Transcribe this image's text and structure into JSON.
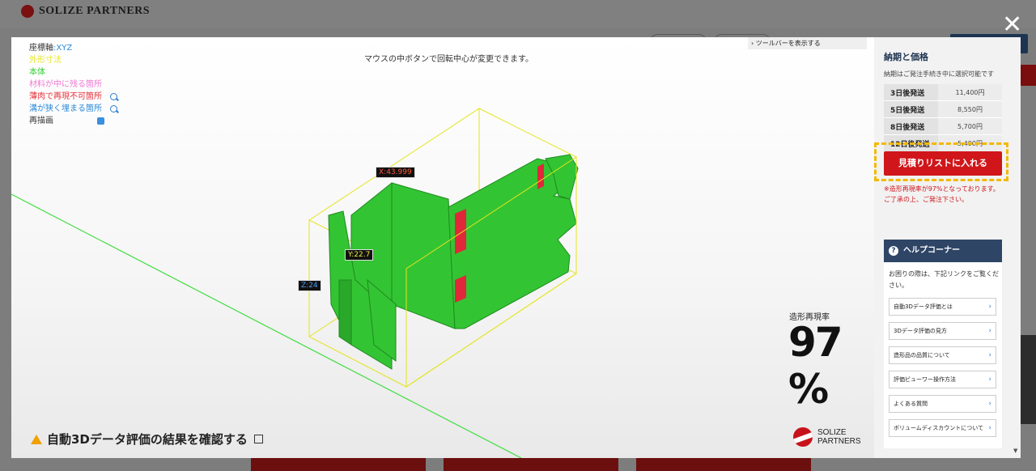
{
  "background": {
    "brand": "SOLIZE PARTNERS",
    "close_label": "✕"
  },
  "viewer": {
    "legend": [
      {
        "label": "座標軸",
        "suffix": "XYZ",
        "color": "#333333",
        "has_search": false
      },
      {
        "label": "外形寸法",
        "color": "#e6e62a",
        "has_search": false
      },
      {
        "label": "本体",
        "color": "#2fcf2f",
        "has_search": false
      },
      {
        "label": "材料が中に残る箇所",
        "color": "#f07ad2",
        "has_search": false
      },
      {
        "label": "薄肉で再現不可箇所",
        "color": "#e8303a",
        "has_search": true
      },
      {
        "label": "溝が狭く埋まる箇所",
        "color": "#2b8ad8",
        "has_search": true
      },
      {
        "label": "再描画",
        "color": "#333333",
        "has_search": false
      }
    ],
    "hint": "マウスの中ボタンで回転中心が変更できます。",
    "toolbar_toggle": "› ツールバーを表示する",
    "dimensions": {
      "x": "X:43.999",
      "y": "Y:22.7",
      "z": "Z:24"
    },
    "rate_label": "造形再現率",
    "rate_value": "97 %",
    "footer_link": "自動3Dデータ評価の結果を確認する",
    "brand_line1": "SOLIZE",
    "brand_line2": "PARTNERS",
    "colors": {
      "body": "#33c433",
      "bbox": "#e4e41c",
      "thin": "#e0283a",
      "axis": "#42dd42"
    }
  },
  "panel": {
    "title": "納期と価格",
    "note": "納期はご発注手続き中に選択可能です",
    "prices": [
      {
        "days": "3日後発送",
        "price": "11,400円"
      },
      {
        "days": "5日後発送",
        "price": "8,550円"
      },
      {
        "days": "8日後発送",
        "price": "5,700円"
      },
      {
        "days": "12日後発送",
        "price": "5,490円"
      }
    ],
    "quote_button": "見積りリストに入れる",
    "warning": "※造形再現率が97%となっております。ご了承の上、ご発注下さい。",
    "help": {
      "title": "ヘルプコーナー",
      "intro": "お困りの際は、下記リンクをご覧ください。",
      "links": [
        "自動3Dデータ評価とは",
        "3Dデータ評価の見方",
        "造形品の品質について",
        "評価ビューワー操作方法",
        "よくある質問",
        "ボリュームディスカウントについて"
      ]
    }
  }
}
